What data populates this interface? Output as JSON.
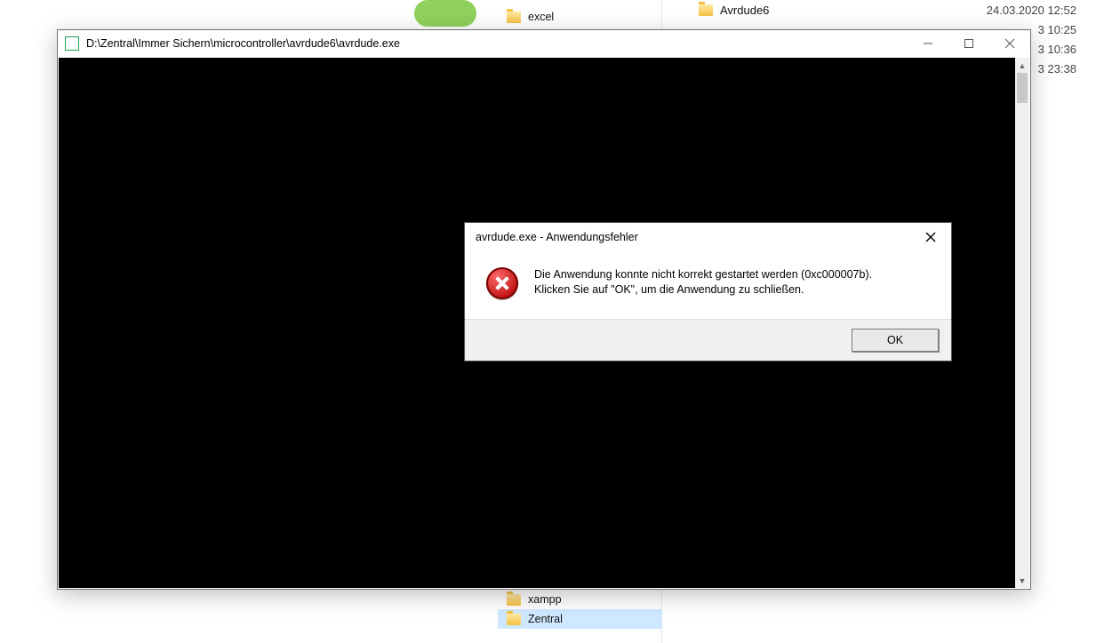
{
  "explorer_background": {
    "mid_panel": {
      "top_partial_item": "excel",
      "bottom_items": [
        {
          "label": "xampp",
          "selected": false
        },
        {
          "label": "Zentral",
          "selected": true
        }
      ]
    },
    "right_panel": {
      "rows": [
        {
          "name": "Avrdude6",
          "date": "24.03.2020 12:52"
        }
      ],
      "partial_dates": [
        "3 10:25",
        "3 10:36",
        "3 23:38"
      ]
    }
  },
  "console_window": {
    "title": "D:\\Zentral\\Immer Sichern\\microcontroller\\avrdude6\\avrdude.exe"
  },
  "error_dialog": {
    "title": "avrdude.exe - Anwendungsfehler",
    "message_line1": "Die Anwendung konnte nicht korrekt gestartet werden (0xc000007b).",
    "message_line2": "Klicken Sie auf \"OK\", um die Anwendung zu schließen.",
    "ok_label": "OK"
  }
}
